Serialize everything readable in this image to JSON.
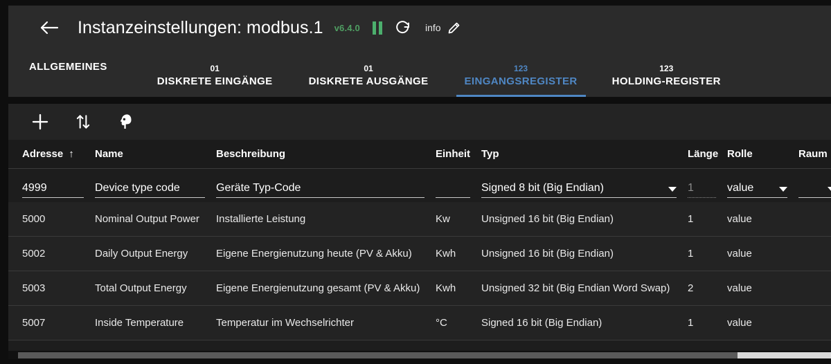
{
  "header": {
    "back_icon": "arrow-left-icon",
    "title": "Instanzeinstellungen: modbus.1",
    "version": "v6.4.0",
    "pause_icon": "pause-icon",
    "refresh_icon": "refresh-icon",
    "info_label": "info",
    "edit_icon": "pencil-icon",
    "version_color": "#4f9e62"
  },
  "tabs": [
    {
      "badge": "",
      "label": "ALLGEMEINES",
      "active": false
    },
    {
      "badge": "01",
      "label": "DISKRETE EINGÄNGE",
      "active": false
    },
    {
      "badge": "01",
      "label": "DISKRETE AUSGÄNGE",
      "active": false
    },
    {
      "badge": "123",
      "label": "EINGANGSREGISTER",
      "active": true
    },
    {
      "badge": "123",
      "label": "HOLDING-REGISTER",
      "active": false
    }
  ],
  "tab_accent": "#4f87c4",
  "toolbar": {
    "add_icon": "plus-icon",
    "sort_icon": "sort-updown-icon",
    "head_icon": "head-profile-icon"
  },
  "table": {
    "columns": [
      {
        "key": "address",
        "label": "Adresse",
        "sorted": true,
        "sort_dir": "↑"
      },
      {
        "key": "name",
        "label": "Name",
        "sorted": false
      },
      {
        "key": "description",
        "label": "Beschreibung",
        "sorted": false
      },
      {
        "key": "unit",
        "label": "Einheit",
        "sorted": false
      },
      {
        "key": "type",
        "label": "Typ",
        "sorted": false
      },
      {
        "key": "length",
        "label": "Länge",
        "sorted": false
      },
      {
        "key": "role",
        "label": "Rolle",
        "sorted": false
      },
      {
        "key": "room",
        "label": "Raum",
        "sorted": false
      }
    ],
    "edit_row": {
      "address": "4999",
      "name": "Device type code",
      "description": "Geräte Typ-Code",
      "unit": "",
      "type": "Signed 8 bit (Big Endian)",
      "length": "1",
      "role": "value",
      "room": ""
    },
    "rows": [
      {
        "address": "5000",
        "name": "Nominal Output Power",
        "description": "Installierte Leistung",
        "unit": "Kw",
        "type": "Unsigned 16 bit (Big Endian)",
        "length": "1",
        "role": "value",
        "room": ""
      },
      {
        "address": "5002",
        "name": "Daily Output Energy",
        "description": "Eigene Energienutzung heute (PV & Akku)",
        "unit": "Kwh",
        "type": "Unsigned 16 bit (Big Endian)",
        "length": "1",
        "role": "value",
        "room": ""
      },
      {
        "address": "5003",
        "name": "Total Output Energy",
        "description": "Eigene Energienutzung gesamt (PV & Akku)",
        "unit": "Kwh",
        "type": "Unsigned 32 bit (Big Endian Word Swap)",
        "length": "2",
        "role": "value",
        "room": ""
      },
      {
        "address": "5007",
        "name": "Inside Temperature",
        "description": "Temperatur im Wechselrichter",
        "unit": "°C",
        "type": "Signed 16 bit (Big Endian)",
        "length": "1",
        "role": "value",
        "room": ""
      }
    ]
  },
  "scrollbar": {
    "name": "horizontal-scrollbar"
  }
}
